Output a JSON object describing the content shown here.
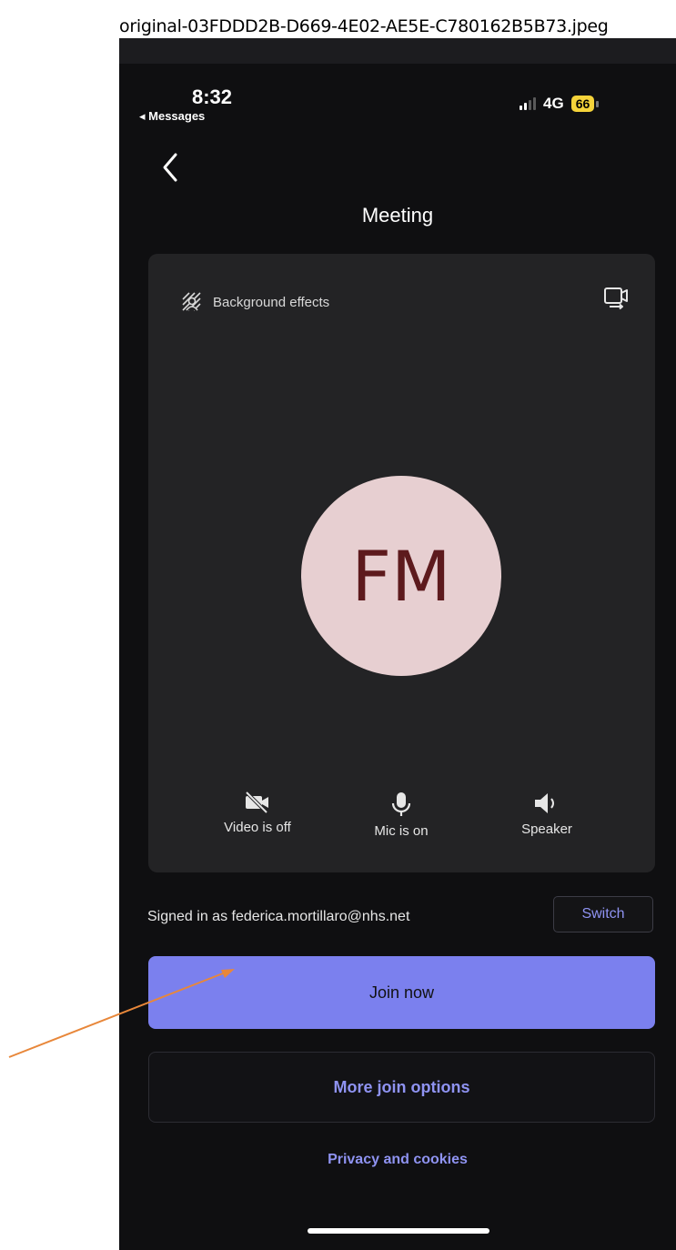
{
  "file": {
    "name": "original-03FDDD2B-D669-4E02-AE5E-C780162B5B73.jpeg"
  },
  "status_bar": {
    "time": "8:32",
    "back_app": "◂ Messages",
    "network": "4G",
    "battery": "66"
  },
  "header": {
    "title": "Meeting"
  },
  "preview": {
    "background_effects_label": "Background effects",
    "avatar_initials": "FM",
    "controls": [
      {
        "label": "Video is off",
        "icon": "video-off-icon"
      },
      {
        "label": "Mic is on",
        "icon": "mic-icon"
      },
      {
        "label": "Speaker",
        "icon": "speaker-icon"
      }
    ]
  },
  "account": {
    "signed_in_text": "Signed in as federica.mortillaro@nhs.net",
    "switch_label": "Switch"
  },
  "actions": {
    "join_label": "Join now",
    "more_options_label": "More join options",
    "privacy_label": "Privacy and cookies"
  },
  "colors": {
    "accent": "#7b80ee",
    "link": "#8f93f2",
    "background": "#0f0f11",
    "card": "#232325",
    "avatar_bg": "#e7cfd1",
    "avatar_text": "#5d1a1d",
    "annotation_arrow": "#e8873a"
  }
}
